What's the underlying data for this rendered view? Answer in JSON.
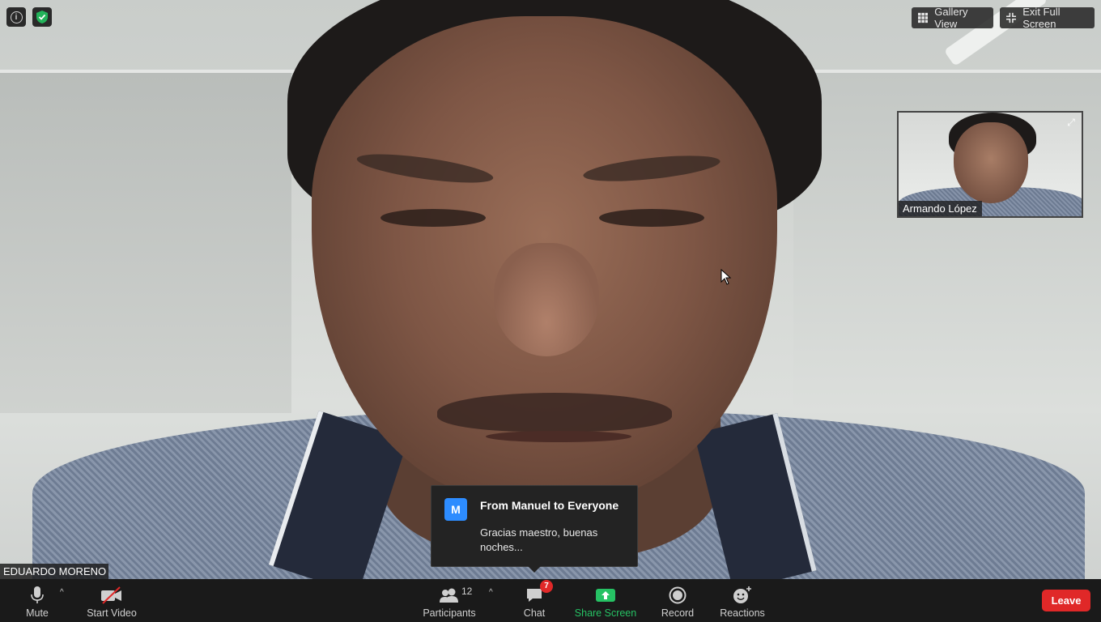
{
  "speaker": {
    "name": "EDUARDO MORENO"
  },
  "thumbnail": {
    "name": "Armando López"
  },
  "top_bar": {
    "gallery_view": "Gallery View",
    "exit_full_screen": "Exit Full Screen"
  },
  "chat_toast": {
    "avatar_initial": "M",
    "title": "From Manuel to Everyone",
    "message": "Gracias maestro, buenas noches..."
  },
  "toolbar": {
    "mute": "Mute",
    "start_video": "Start Video",
    "participants": "Participants",
    "participants_count": "12",
    "chat": "Chat",
    "chat_badge": "7",
    "share_screen": "Share Screen",
    "record": "Record",
    "reactions": "Reactions",
    "leave": "Leave"
  },
  "colors": {
    "share_green": "#26c264",
    "leave_red": "#e02828",
    "avatar_blue": "#2d8cff",
    "shield_green": "#23b35a"
  }
}
